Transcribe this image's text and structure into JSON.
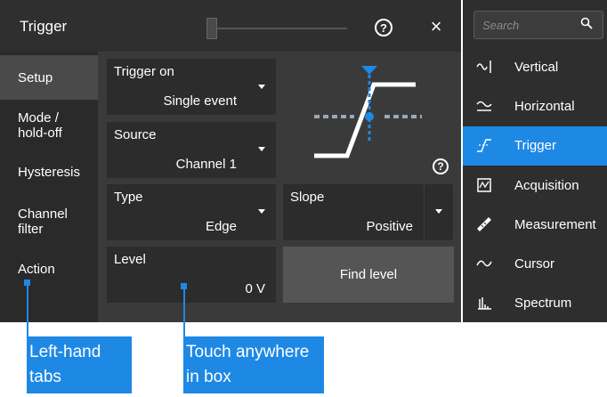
{
  "dialog": {
    "title": "Trigger",
    "help_label": "?",
    "close_label": "×"
  },
  "tabs": [
    {
      "label": "Setup",
      "active": true
    },
    {
      "label": "Mode / hold-off",
      "active": false
    },
    {
      "label": "Hysteresis",
      "active": false
    },
    {
      "label": "Channel filter",
      "active": false
    },
    {
      "label": "Action",
      "active": false
    }
  ],
  "fields": {
    "trigger_on": {
      "label": "Trigger on",
      "value": "Single event"
    },
    "source": {
      "label": "Source",
      "value": "Channel 1"
    },
    "type": {
      "label": "Type",
      "value": "Edge"
    },
    "slope": {
      "label": "Slope",
      "value": "Positive"
    },
    "level": {
      "label": "Level",
      "value": "0 V"
    }
  },
  "find_level_label": "Find level",
  "help2_label": "?",
  "search": {
    "placeholder": "Search"
  },
  "menu": [
    {
      "label": "Vertical",
      "icon": "vertical-icon",
      "active": false
    },
    {
      "label": "Horizontal",
      "icon": "horizontal-icon",
      "active": false
    },
    {
      "label": "Trigger",
      "icon": "trigger-icon",
      "active": true
    },
    {
      "label": "Acquisition",
      "icon": "acquisition-icon",
      "active": false
    },
    {
      "label": "Measurement",
      "icon": "measurement-icon",
      "active": false
    },
    {
      "label": "Cursor",
      "icon": "cursor-icon",
      "active": false
    },
    {
      "label": "Spectrum",
      "icon": "spectrum-icon",
      "active": false
    }
  ],
  "annotations": {
    "left_hand": "Left-hand tabs",
    "touch_anywhere": "Touch anywhere in box"
  },
  "colors": {
    "accent": "#1e88e5",
    "panel": "#3a3a3a",
    "field": "#2c2c2c"
  }
}
